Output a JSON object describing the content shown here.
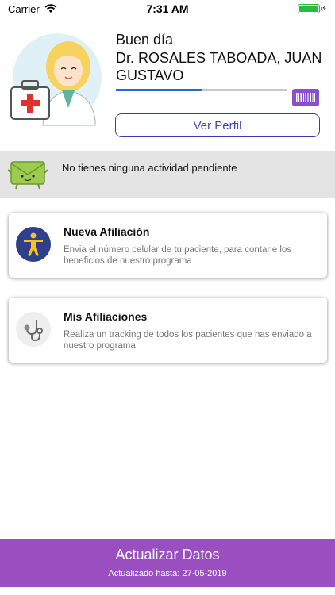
{
  "status_bar": {
    "carrier": "Carrier",
    "time": "7:31 AM",
    "battery_level": 1.0
  },
  "profile": {
    "greeting": "Buen día",
    "doctor_name": "Dr. ROSALES TABOADA, JUAN GUSTAVO",
    "progress_fraction": 0.5,
    "view_profile_label": "Ver Perfil"
  },
  "notice": {
    "text": "No tienes ninguna actividad pendiente"
  },
  "cards": [
    {
      "title": "Nueva Afiliación",
      "description": "Envia el número celular de tu paciente, para contarle los beneficios de nuestro programa",
      "icon": "person-icon"
    },
    {
      "title": "Mis Afiliaciones",
      "description": "Realiza un tracking de todos los pacientes que has enviado a nuestro programa",
      "icon": "stethoscope-icon"
    }
  ],
  "footer": {
    "title": "Actualizar Datos",
    "subtitle": "Actualizado hasta: 27-05-2019"
  },
  "colors": {
    "accent_blue": "#3f46c8",
    "progress_blue": "#1f6fd6",
    "footer_purple": "#9a4fc0",
    "barcode_purple": "#8a4fd1",
    "notice_gray": "#e4e4e4"
  }
}
